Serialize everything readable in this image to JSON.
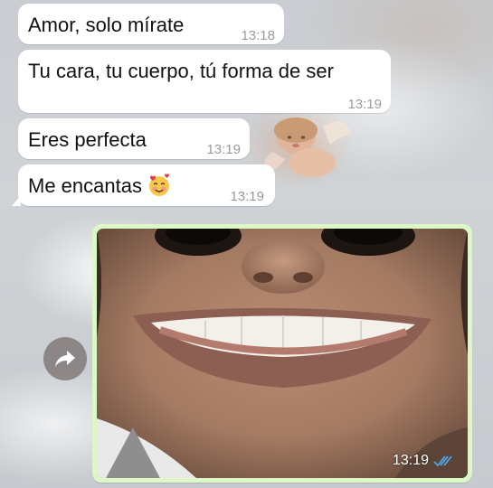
{
  "messages": [
    {
      "text": "Amor, solo mírate",
      "time": "13:18"
    },
    {
      "text": "Tu cara, tu cuerpo, tú forma de ser",
      "time": "13:19"
    },
    {
      "text": "Eres perfecta",
      "time": "13:19"
    },
    {
      "text": "Me encantas",
      "emoji": "smiling-face-with-hearts-icon",
      "time": "13:19"
    }
  ],
  "photo_message": {
    "time": "13:19",
    "status": "read",
    "status_icon": "double-check-icon",
    "bubble_color": "#dcf8c6",
    "tick_color": "#4fa3e0"
  },
  "forward_button": {
    "icon": "forward-arrow-icon"
  },
  "colors": {
    "incoming_bubble": "#ffffff",
    "timestamp": "#9a9a9a"
  }
}
